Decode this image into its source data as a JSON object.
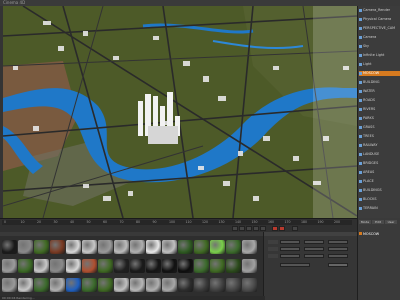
{
  "window": {
    "title": "Cinema 4D"
  },
  "object_manager": {
    "items": [
      {
        "label": "Camera_Render",
        "icon": "camera-icon",
        "highlight": false
      },
      {
        "label": "Physical Camera",
        "icon": "camera-icon",
        "highlight": false
      },
      {
        "label": "PERSPECTIVE_CAM",
        "icon": "camera-icon",
        "highlight": false
      },
      {
        "label": "Camera",
        "icon": "camera-icon",
        "highlight": false
      },
      {
        "label": "Sky",
        "icon": "sky-icon",
        "highlight": false
      },
      {
        "label": "Infinite Light",
        "icon": "light-icon",
        "highlight": false
      },
      {
        "label": "Light",
        "icon": "light-icon",
        "highlight": false
      },
      {
        "label": "MOSCOW",
        "icon": "null-icon",
        "highlight": true
      },
      {
        "label": "BUILDING",
        "icon": "layer-icon",
        "highlight": false
      },
      {
        "label": "WATER",
        "icon": "layer-icon",
        "highlight": false
      },
      {
        "label": "ROADS",
        "icon": "layer-icon",
        "highlight": false
      },
      {
        "label": "RIVERS",
        "icon": "layer-icon",
        "highlight": false
      },
      {
        "label": "PARKS",
        "icon": "layer-icon",
        "highlight": false
      },
      {
        "label": "GRASS",
        "icon": "layer-icon",
        "highlight": false
      },
      {
        "label": "TREES",
        "icon": "layer-icon",
        "highlight": false
      },
      {
        "label": "RAILWAY",
        "icon": "layer-icon",
        "highlight": false
      },
      {
        "label": "LANDUSE",
        "icon": "layer-icon",
        "highlight": false
      },
      {
        "label": "BRIDGES",
        "icon": "layer-icon",
        "highlight": false
      },
      {
        "label": "AREAS",
        "icon": "layer-icon",
        "highlight": false
      },
      {
        "label": "PLACE",
        "icon": "layer-icon",
        "highlight": false
      },
      {
        "label": "BUILDINGS",
        "icon": "layer-icon",
        "highlight": false
      },
      {
        "label": "BLOCKS",
        "icon": "layer-icon",
        "highlight": false
      },
      {
        "label": "TERRAIN",
        "icon": "layer-icon",
        "highlight": false
      }
    ]
  },
  "timeline": {
    "ticks": [
      "0",
      "10",
      "20",
      "30",
      "40",
      "50",
      "60",
      "70",
      "80",
      "90",
      "100",
      "110",
      "120",
      "130",
      "140",
      "150",
      "160",
      "170",
      "180",
      "190",
      "200"
    ],
    "current_frame": "0 F"
  },
  "attributes": {
    "tabs": [
      "Mode",
      "Edit",
      "User"
    ],
    "selected": "MOSCOW"
  },
  "materials": {
    "rows": [
      [
        "#1a1a1a",
        "#8a8a8a",
        "#3f6a22",
        "#7a3a22",
        "#d8d8d8",
        "#c8c8c8",
        "#9a9a9a",
        "#bcbcbc",
        "#b0b0b0",
        "#e8e8e8",
        "#c0c0c0",
        "#2d5a20",
        "#3f6a22",
        "#7ad04a",
        "#3a6a2a",
        "#a8a8a8"
      ],
      [
        "#9c9c9c",
        "#3b6a24",
        "#c8c8c8",
        "#8a8a8a",
        "#d8d8d8",
        "#b05030",
        "#3f6a22",
        "#202020",
        "#1a1a1a",
        "#151515",
        "#111111",
        "#0e0e0e",
        "#3a6a2a",
        "#3f6a22",
        "#2a4a1a",
        "#a0a0a0"
      ],
      [
        "#9a9a9a",
        "#c8c8c8",
        "#3a6a2a",
        "#b0b0b0",
        "#1f5fbf",
        "#3a6a2a",
        "#3f6a22",
        "#c0c0c0",
        "#b8b8b8",
        "#b0b0b0",
        "#a8a8a8",
        "#2c2c2c",
        "#3a3a3a",
        "#404040",
        "#444444",
        "#4a4a4a"
      ]
    ]
  },
  "status": {
    "text": "00:00:04 Rendering..."
  }
}
